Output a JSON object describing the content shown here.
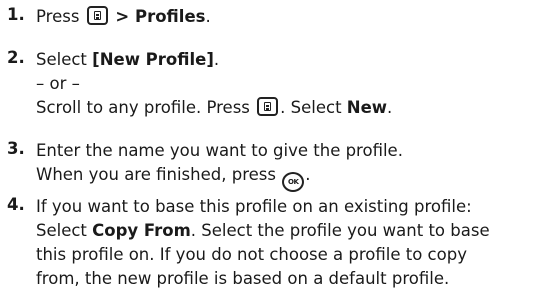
{
  "steps": [
    {
      "number": "1.",
      "lines": [
        {
          "a": "Press ",
          "b": " > Profiles",
          "c": "."
        }
      ]
    },
    {
      "number": "2.",
      "lines": [
        {
          "a": "Select ",
          "b": "[New Profile]",
          "c": "."
        },
        {
          "a": "– or –"
        },
        {
          "a": "Scroll to any profile. Press ",
          "b": ". Select ",
          "c": "New",
          "d": "."
        }
      ]
    },
    {
      "number": "3.",
      "lines": [
        {
          "a": "Enter the name you want to give the profile."
        },
        {
          "a": "When you are finished, press ",
          "b": "."
        }
      ]
    },
    {
      "number": "4.",
      "lines": [
        {
          "a": "If you want to base this profile on an existing profile:"
        },
        {
          "a": "Select ",
          "b": "Copy From",
          "c": ". Select the profile you want to base"
        },
        {
          "a": "this profile on. If you do not choose a profile to copy"
        },
        {
          "a": "from, the new profile is based on a default profile."
        }
      ]
    }
  ],
  "icons": {
    "menu_key": "menu-key-icon",
    "ok_key": "ok-key-icon",
    "ok_key_label": "OK"
  }
}
